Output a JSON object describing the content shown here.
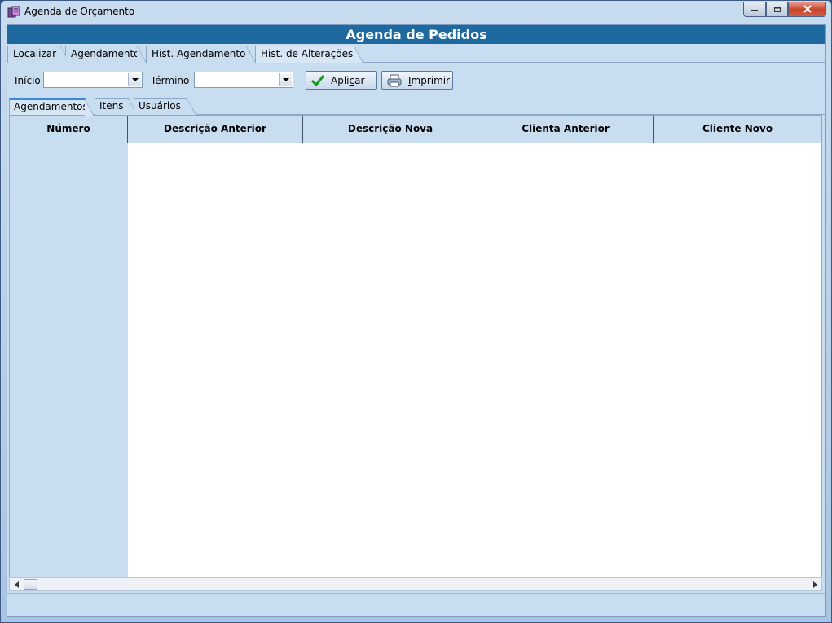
{
  "window": {
    "title": "Agenda de Orçamento",
    "icon": "app-icon"
  },
  "header": {
    "title": "Agenda de Pedidos"
  },
  "tabs_top": [
    {
      "label": "Localizar",
      "active": false
    },
    {
      "label": "Agendamento",
      "active": false
    },
    {
      "label": "Hist. Agendamentos",
      "active": false
    },
    {
      "label": "Hist. de Alterações",
      "active": true
    }
  ],
  "filters": {
    "start_label": "Início",
    "start_value": "",
    "end_label": "Término",
    "end_value": "",
    "apply_label_pre": "Apli",
    "apply_label_key": "c",
    "apply_label_post": "ar",
    "print_label_key": "I",
    "print_label_post": "mprimir"
  },
  "tabs_inner": [
    {
      "label": "Agendamentos",
      "active": true
    },
    {
      "label": "Itens",
      "active": false
    },
    {
      "label": "Usuários",
      "active": false
    }
  ],
  "grid": {
    "columns": [
      "Número",
      "Descrição Anterior",
      "Descrição Nova",
      "Clienta Anterior",
      "Cliente Novo"
    ],
    "rows": []
  },
  "colors": {
    "header_bar": "#1e6aa0",
    "client_bg": "#c9ddf1",
    "active_tab_accent": "#3a8ad8"
  }
}
